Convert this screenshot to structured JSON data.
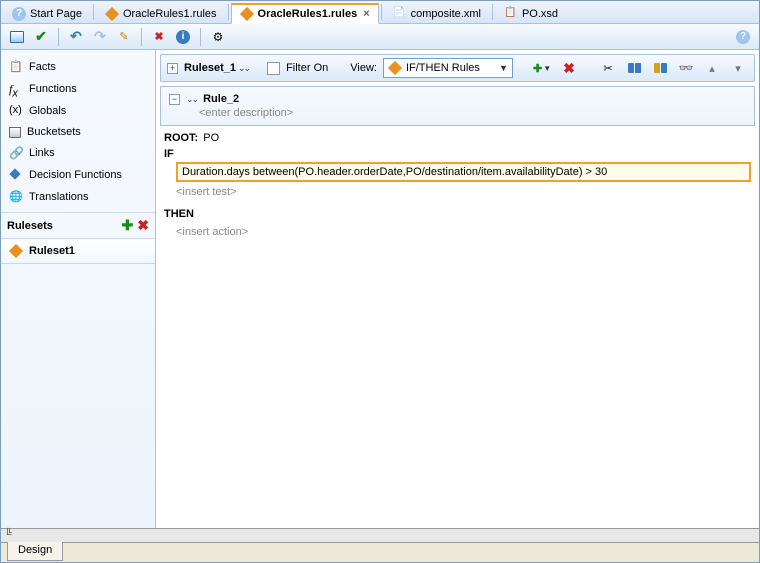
{
  "tabs": [
    {
      "label": "Start Page",
      "icon": "help"
    },
    {
      "label": "OracleRules1.rules",
      "icon": "diamond"
    },
    {
      "label": "OracleRules1.rules",
      "icon": "diamond",
      "active": true
    },
    {
      "label": "composite.xml",
      "icon": "xml"
    },
    {
      "label": "PO.xsd",
      "icon": "xsd"
    }
  ],
  "sidebar": {
    "items": [
      {
        "label": "Facts",
        "icon": "facts"
      },
      {
        "label": "Functions",
        "icon": "fx"
      },
      {
        "label": "Globals",
        "icon": "globals"
      },
      {
        "label": "Bucketsets",
        "icon": "bucket"
      },
      {
        "label": "Links",
        "icon": "link"
      },
      {
        "label": "Decision Functions",
        "icon": "decision"
      },
      {
        "label": "Translations",
        "icon": "translations"
      }
    ],
    "section": "Rulesets",
    "ruleset": "Ruleset1"
  },
  "ruleset_bar": {
    "name": "Ruleset_1",
    "filter_label": "Filter On",
    "view_label": "View:",
    "view_value": "IF/THEN Rules"
  },
  "rule": {
    "name": "Rule_2",
    "desc_placeholder": "<enter description>",
    "root_label": "ROOT:",
    "root_value": "PO",
    "if_label": "IF",
    "condition": "Duration.days between(PO.header.orderDate,PO/destination/item.availabilityDate)  >  30",
    "insert_test": "<insert test>",
    "then_label": "THEN",
    "insert_action": "<insert action>"
  },
  "bottom": {
    "strip": "╚",
    "tab": "Design"
  }
}
